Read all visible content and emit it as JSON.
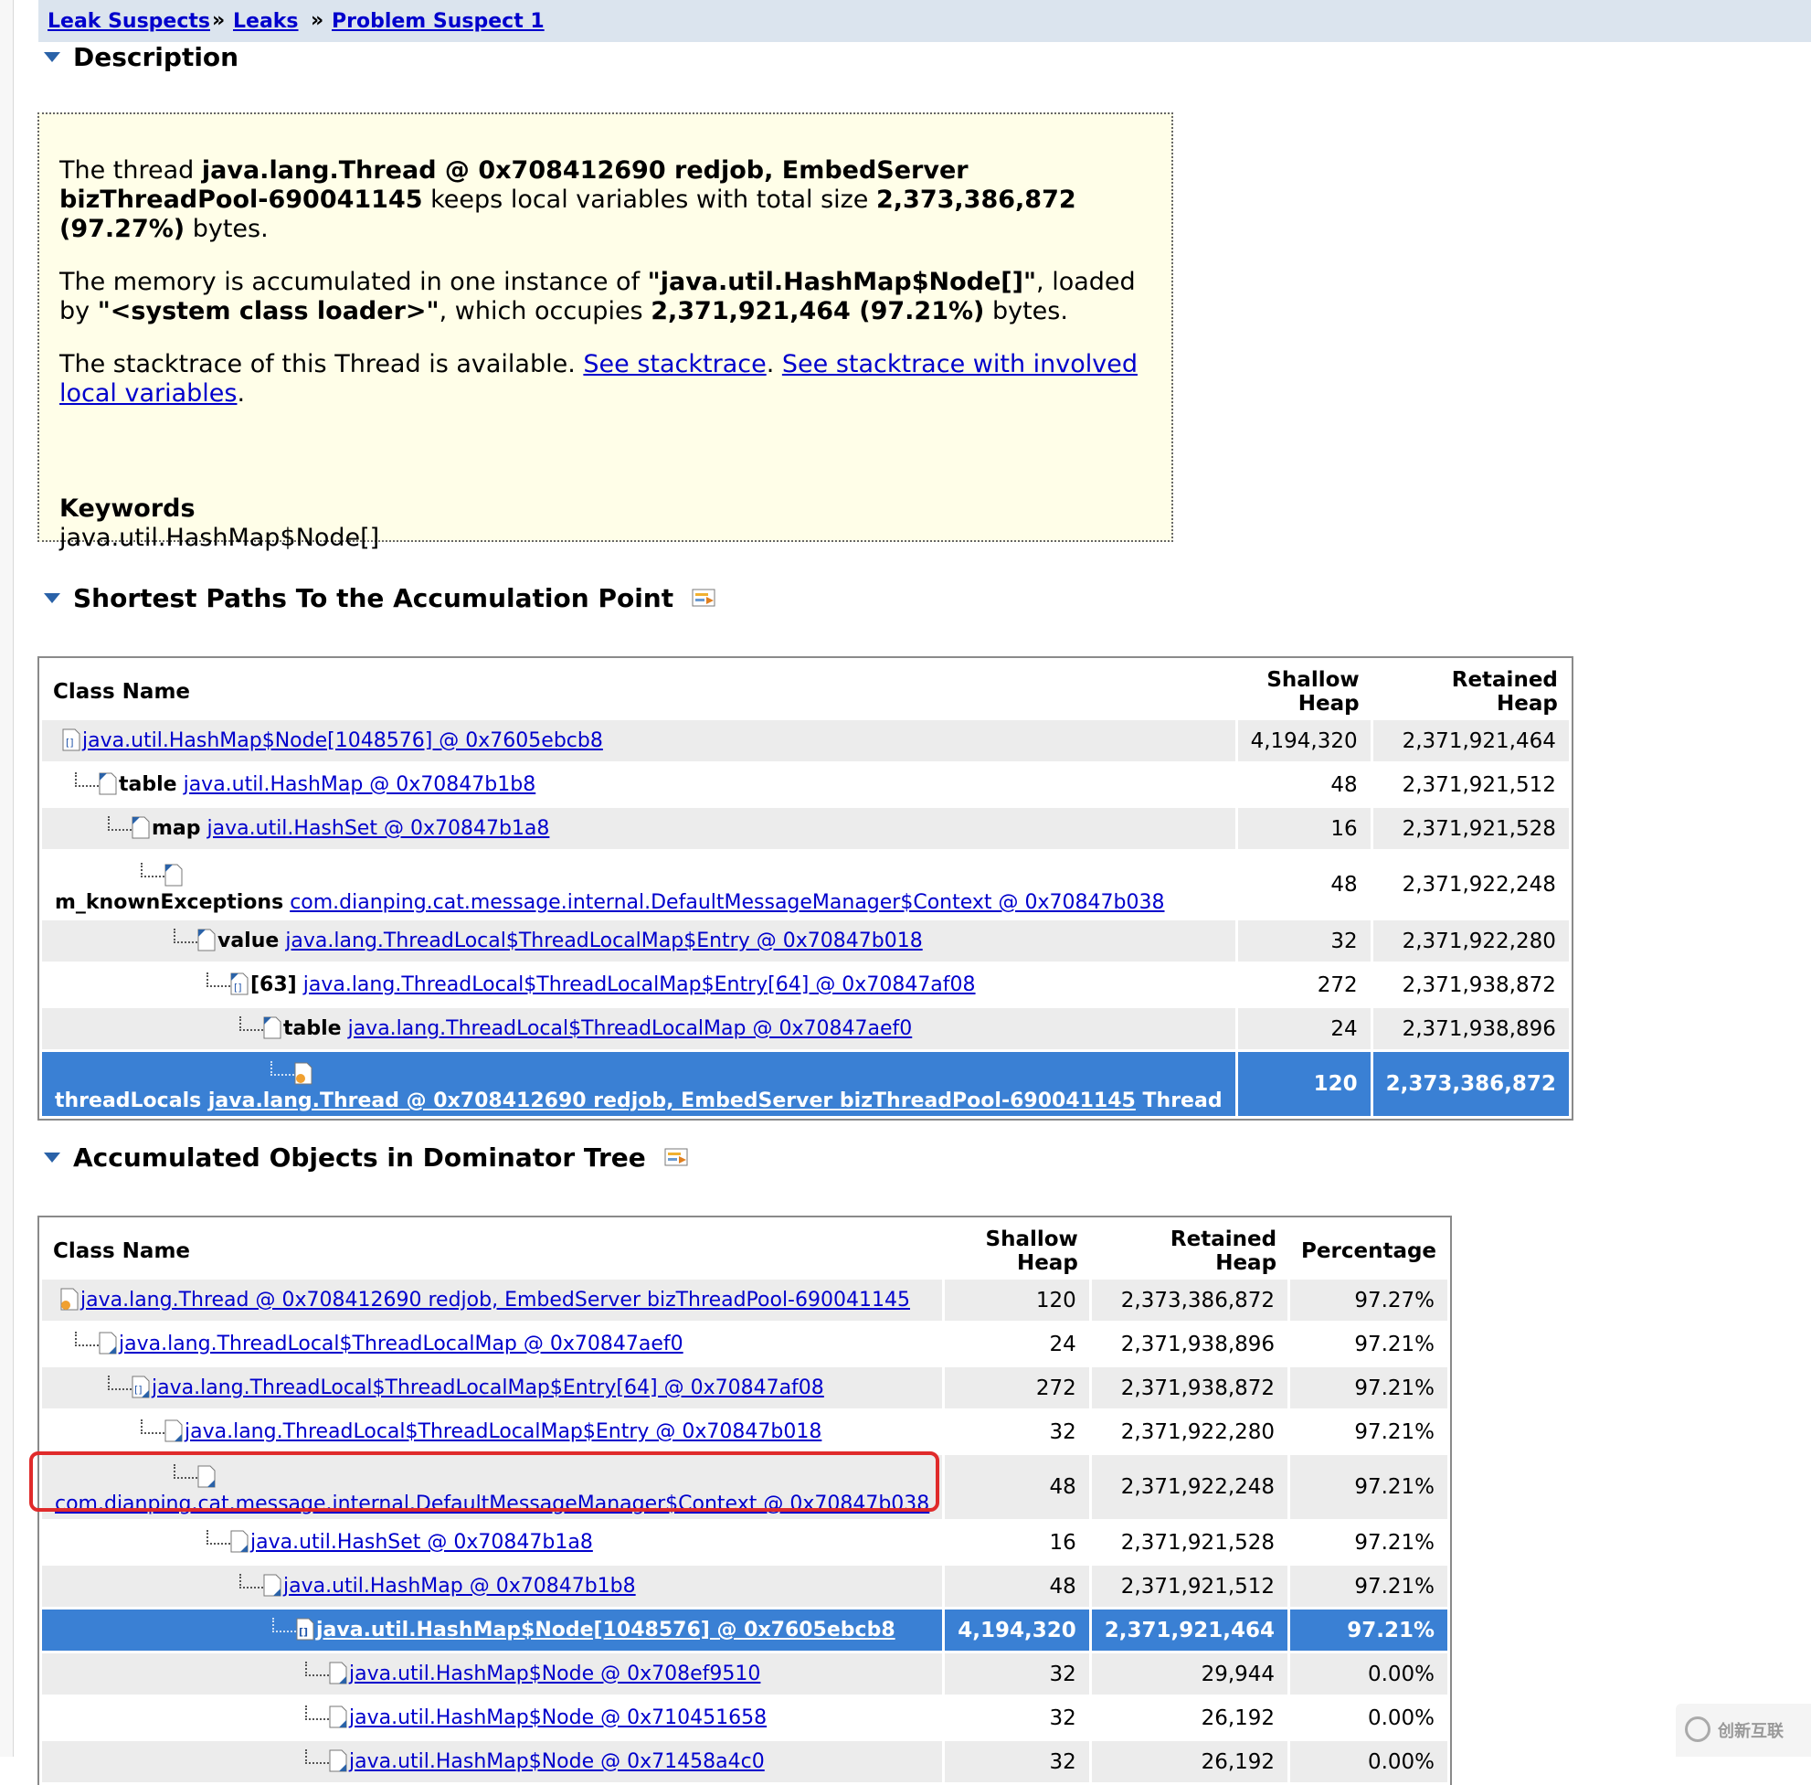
{
  "breadcrumb": {
    "items": [
      "Leak Suspects",
      "Leaks",
      "Problem Suspect 1"
    ],
    "separator": "»"
  },
  "description": {
    "title": "Description",
    "p1": {
      "t1": "The thread ",
      "b1": "java.lang.Thread @ 0x708412690 redjob, EmbedServer bizThreadPool-690041145",
      "t2": " keeps local variables with total size ",
      "b2": "2,373,386,872 (97.27%)",
      "t3": " bytes."
    },
    "p2": {
      "t1": "The memory is accumulated in one instance of ",
      "b1": "\"java.util.HashMap$Node[]\"",
      "t2": ", loaded by ",
      "b2": "\"<system class loader>\"",
      "t3": ", which occupies ",
      "b3": "2,371,921,464 (97.21%)",
      "t4": " bytes."
    },
    "p3": {
      "t1": "The stacktrace of this Thread is available. ",
      "link1": "See stacktrace",
      "t2": ". ",
      "link2": "See stacktrace with involved local variables",
      "t3": "."
    },
    "keywords_title": "Keywords",
    "keywords_value": "java.util.HashMap$Node[]"
  },
  "shortest_paths": {
    "title": "Shortest Paths To the Accumulation Point",
    "columns": [
      "Class Name",
      "Shallow Heap",
      "Retained Heap"
    ],
    "rows": [
      {
        "field": "",
        "link": "java.util.HashMap$Node[1048576] @ 0x7605ebcb8",
        "suffix": "",
        "shallow": "4,194,320",
        "retained": "2,371,921,464"
      },
      {
        "field": "table",
        "link": "java.util.HashMap @ 0x70847b1b8",
        "suffix": "",
        "shallow": "48",
        "retained": "2,371,921,512"
      },
      {
        "field": "map",
        "link": "java.util.HashSet @ 0x70847b1a8",
        "suffix": "",
        "shallow": "16",
        "retained": "2,371,921,528"
      },
      {
        "field": "m_knownExceptions",
        "link": "com.dianping.cat.message.internal.DefaultMessageManager$Context @ 0x70847b038",
        "suffix": "",
        "shallow": "48",
        "retained": "2,371,922,248"
      },
      {
        "field": "value",
        "link": "java.lang.ThreadLocal$ThreadLocalMap$Entry @ 0x70847b018",
        "suffix": "",
        "shallow": "32",
        "retained": "2,371,922,280"
      },
      {
        "field": "[63]",
        "link": "java.lang.ThreadLocal$ThreadLocalMap$Entry[64] @ 0x70847af08",
        "suffix": "",
        "shallow": "272",
        "retained": "2,371,938,872"
      },
      {
        "field": "table",
        "link": "java.lang.ThreadLocal$ThreadLocalMap @ 0x70847aef0",
        "suffix": "",
        "shallow": "24",
        "retained": "2,371,938,896"
      },
      {
        "field": "threadLocals",
        "link": "java.lang.Thread @ 0x708412690 redjob, EmbedServer bizThreadPool-690041145",
        "suffix": "Thread",
        "shallow": "120",
        "retained": "2,373,386,872"
      }
    ]
  },
  "dominator": {
    "title": "Accumulated Objects in Dominator Tree",
    "columns": [
      "Class Name",
      "Shallow Heap",
      "Retained Heap",
      "Percentage"
    ],
    "rows": [
      {
        "link": "java.lang.Thread @ 0x708412690 redjob, EmbedServer bizThreadPool-690041145",
        "shallow": "120",
        "retained": "2,373,386,872",
        "pct": "97.27%"
      },
      {
        "link": "java.lang.ThreadLocal$ThreadLocalMap @ 0x70847aef0",
        "shallow": "24",
        "retained": "2,371,938,896",
        "pct": "97.21%"
      },
      {
        "link": "java.lang.ThreadLocal$ThreadLocalMap$Entry[64] @ 0x70847af08",
        "shallow": "272",
        "retained": "2,371,938,872",
        "pct": "97.21%"
      },
      {
        "link": "java.lang.ThreadLocal$ThreadLocalMap$Entry @ 0x70847b018",
        "shallow": "32",
        "retained": "2,371,922,280",
        "pct": "97.21%"
      },
      {
        "link": "com.dianping.cat.message.internal.DefaultMessageManager$Context @ 0x70847b038",
        "shallow": "48",
        "retained": "2,371,922,248",
        "pct": "97.21%"
      },
      {
        "link": "java.util.HashSet @ 0x70847b1a8",
        "shallow": "16",
        "retained": "2,371,921,528",
        "pct": "97.21%"
      },
      {
        "link": "java.util.HashMap @ 0x70847b1b8",
        "shallow": "48",
        "retained": "2,371,921,512",
        "pct": "97.21%"
      },
      {
        "link": "java.util.HashMap$Node[1048576] @ 0x7605ebcb8",
        "shallow": "4,194,320",
        "retained": "2,371,921,464",
        "pct": "97.21%"
      },
      {
        "link": "java.util.HashMap$Node @ 0x708ef9510",
        "shallow": "32",
        "retained": "29,944",
        "pct": "0.00%"
      },
      {
        "link": "java.util.HashMap$Node @ 0x710451658",
        "shallow": "32",
        "retained": "26,192",
        "pct": "0.00%"
      },
      {
        "link": "java.util.HashMap$Node @ 0x71458a4c0",
        "shallow": "32",
        "retained": "26,192",
        "pct": "0.00%"
      }
    ]
  },
  "watermark": "创新互联",
  "colors": {
    "selection": "#3a80d4",
    "highlight_box": "#e02b2b",
    "description_bg": "#fffee8",
    "link": "#0000cc"
  }
}
